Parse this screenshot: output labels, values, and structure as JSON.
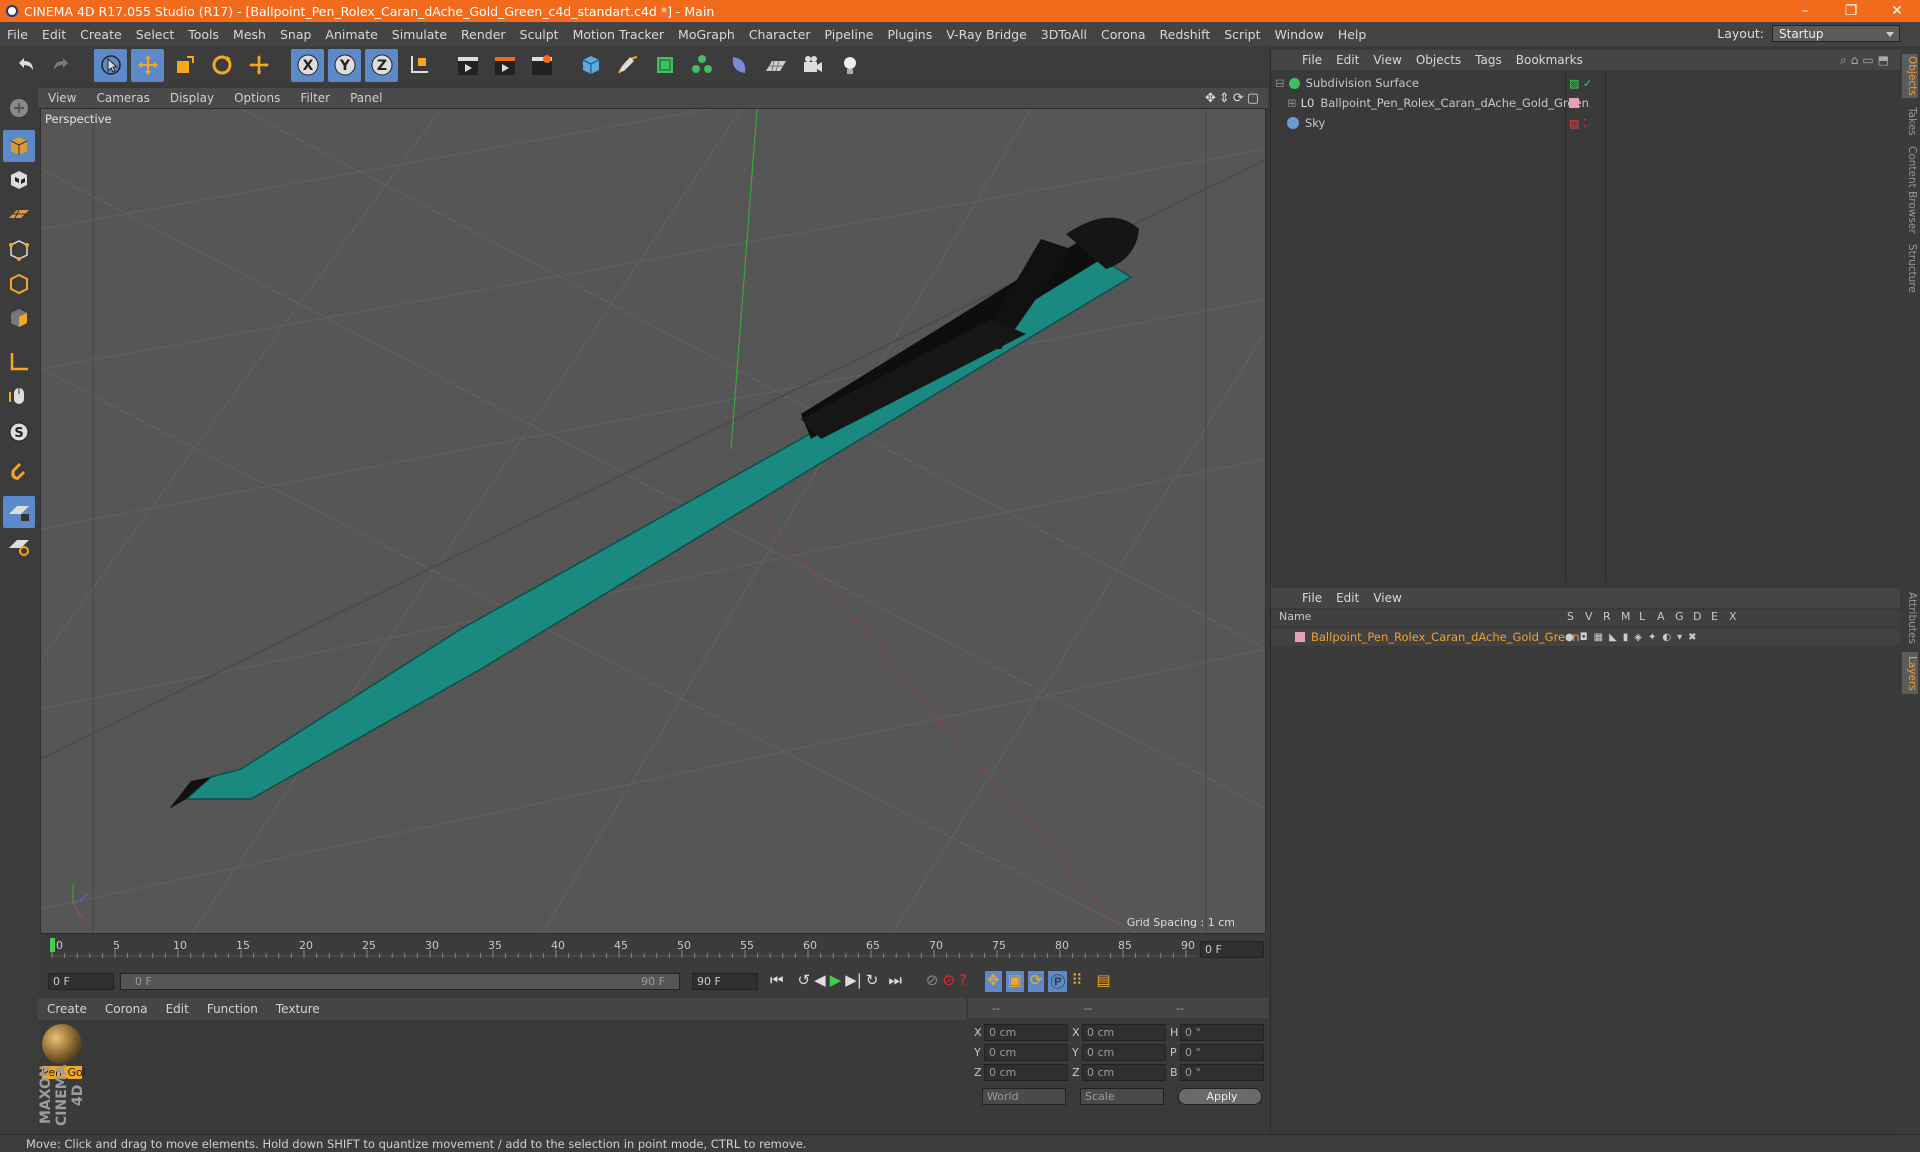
{
  "title": "CINEMA 4D R17.055 Studio (R17) - [Ballpoint_Pen_Rolex_Caran_dAche_Gold_Green_c4d_standart.c4d *] - Main",
  "window_buttons": [
    "–",
    "❐",
    "✕"
  ],
  "menu": [
    "File",
    "Edit",
    "Create",
    "Select",
    "Tools",
    "Mesh",
    "Snap",
    "Animate",
    "Simulate",
    "Render",
    "Sculpt",
    "Motion Tracker",
    "MoGraph",
    "Character",
    "Pipeline",
    "Plugins",
    "V-Ray Bridge",
    "3DToAll",
    "Corona",
    "Redshift",
    "Script",
    "Window",
    "Help"
  ],
  "layout": {
    "label": "Layout:",
    "value": "Startup"
  },
  "viewport": {
    "menu": [
      "View",
      "Cameras",
      "Display",
      "Options",
      "Filter",
      "Panel"
    ],
    "label": "Perspective",
    "grid_spacing": "Grid Spacing : 1 cm"
  },
  "timeline": {
    "ticks": [
      "0",
      "5",
      "10",
      "15",
      "20",
      "25",
      "30",
      "35",
      "40",
      "45",
      "50",
      "55",
      "60",
      "65",
      "70",
      "75",
      "80",
      "85",
      "90"
    ],
    "current_frame": "0 F"
  },
  "transport": {
    "start": "0 F",
    "slider_start": "0 F",
    "slider_end": "90 F",
    "end": "90 F"
  },
  "materials": {
    "menu": [
      "Create",
      "Corona",
      "Edit",
      "Function",
      "Texture"
    ],
    "items": [
      {
        "name": "Pen_Gol"
      }
    ]
  },
  "coords": {
    "headers": [
      "--",
      "--",
      "--"
    ],
    "rows": [
      {
        "a": "X",
        "av": "0 cm",
        "b": "X",
        "bv": "0 cm",
        "c": "H",
        "cv": "0 °"
      },
      {
        "a": "Y",
        "av": "0 cm",
        "b": "Y",
        "bv": "0 cm",
        "c": "P",
        "cv": "0 °"
      },
      {
        "a": "Z",
        "av": "0 cm",
        "b": "Z",
        "bv": "0 cm",
        "c": "B",
        "cv": "0 °"
      }
    ],
    "mode": "World",
    "scale": "Scale",
    "apply": "Apply"
  },
  "objects": {
    "menu": [
      "File",
      "Edit",
      "View",
      "Objects",
      "Tags",
      "Bookmarks"
    ],
    "items": [
      {
        "name": "Subdivision Surface"
      },
      {
        "name": "Ballpoint_Pen_Rolex_Caran_dAche_Gold_Green"
      },
      {
        "name": "Sky"
      }
    ]
  },
  "layers": {
    "menu": [
      "File",
      "Edit",
      "View"
    ],
    "header_name": "Name",
    "columns": [
      "S",
      "V",
      "R",
      "M",
      "L",
      "A",
      "G",
      "D",
      "E",
      "X"
    ],
    "items": [
      {
        "name": "Ballpoint_Pen_Rolex_Caran_dAche_Gold_Green"
      }
    ]
  },
  "right_tabs": [
    "Objects",
    "Takes",
    "Content Browser",
    "Structure",
    "Attributes",
    "Layers"
  ],
  "status": "Move: Click and drag to move elements. Hold down SHIFT to quantize movement / add to the selection in point mode, CTRL to remove.",
  "brand": "MAXON CINEMA 4D",
  "colors": {
    "title_bar": "#f26a1b",
    "accent": "#5c8ac9",
    "pen_body": "#1a8a80",
    "layer_name": "#f0a030"
  }
}
